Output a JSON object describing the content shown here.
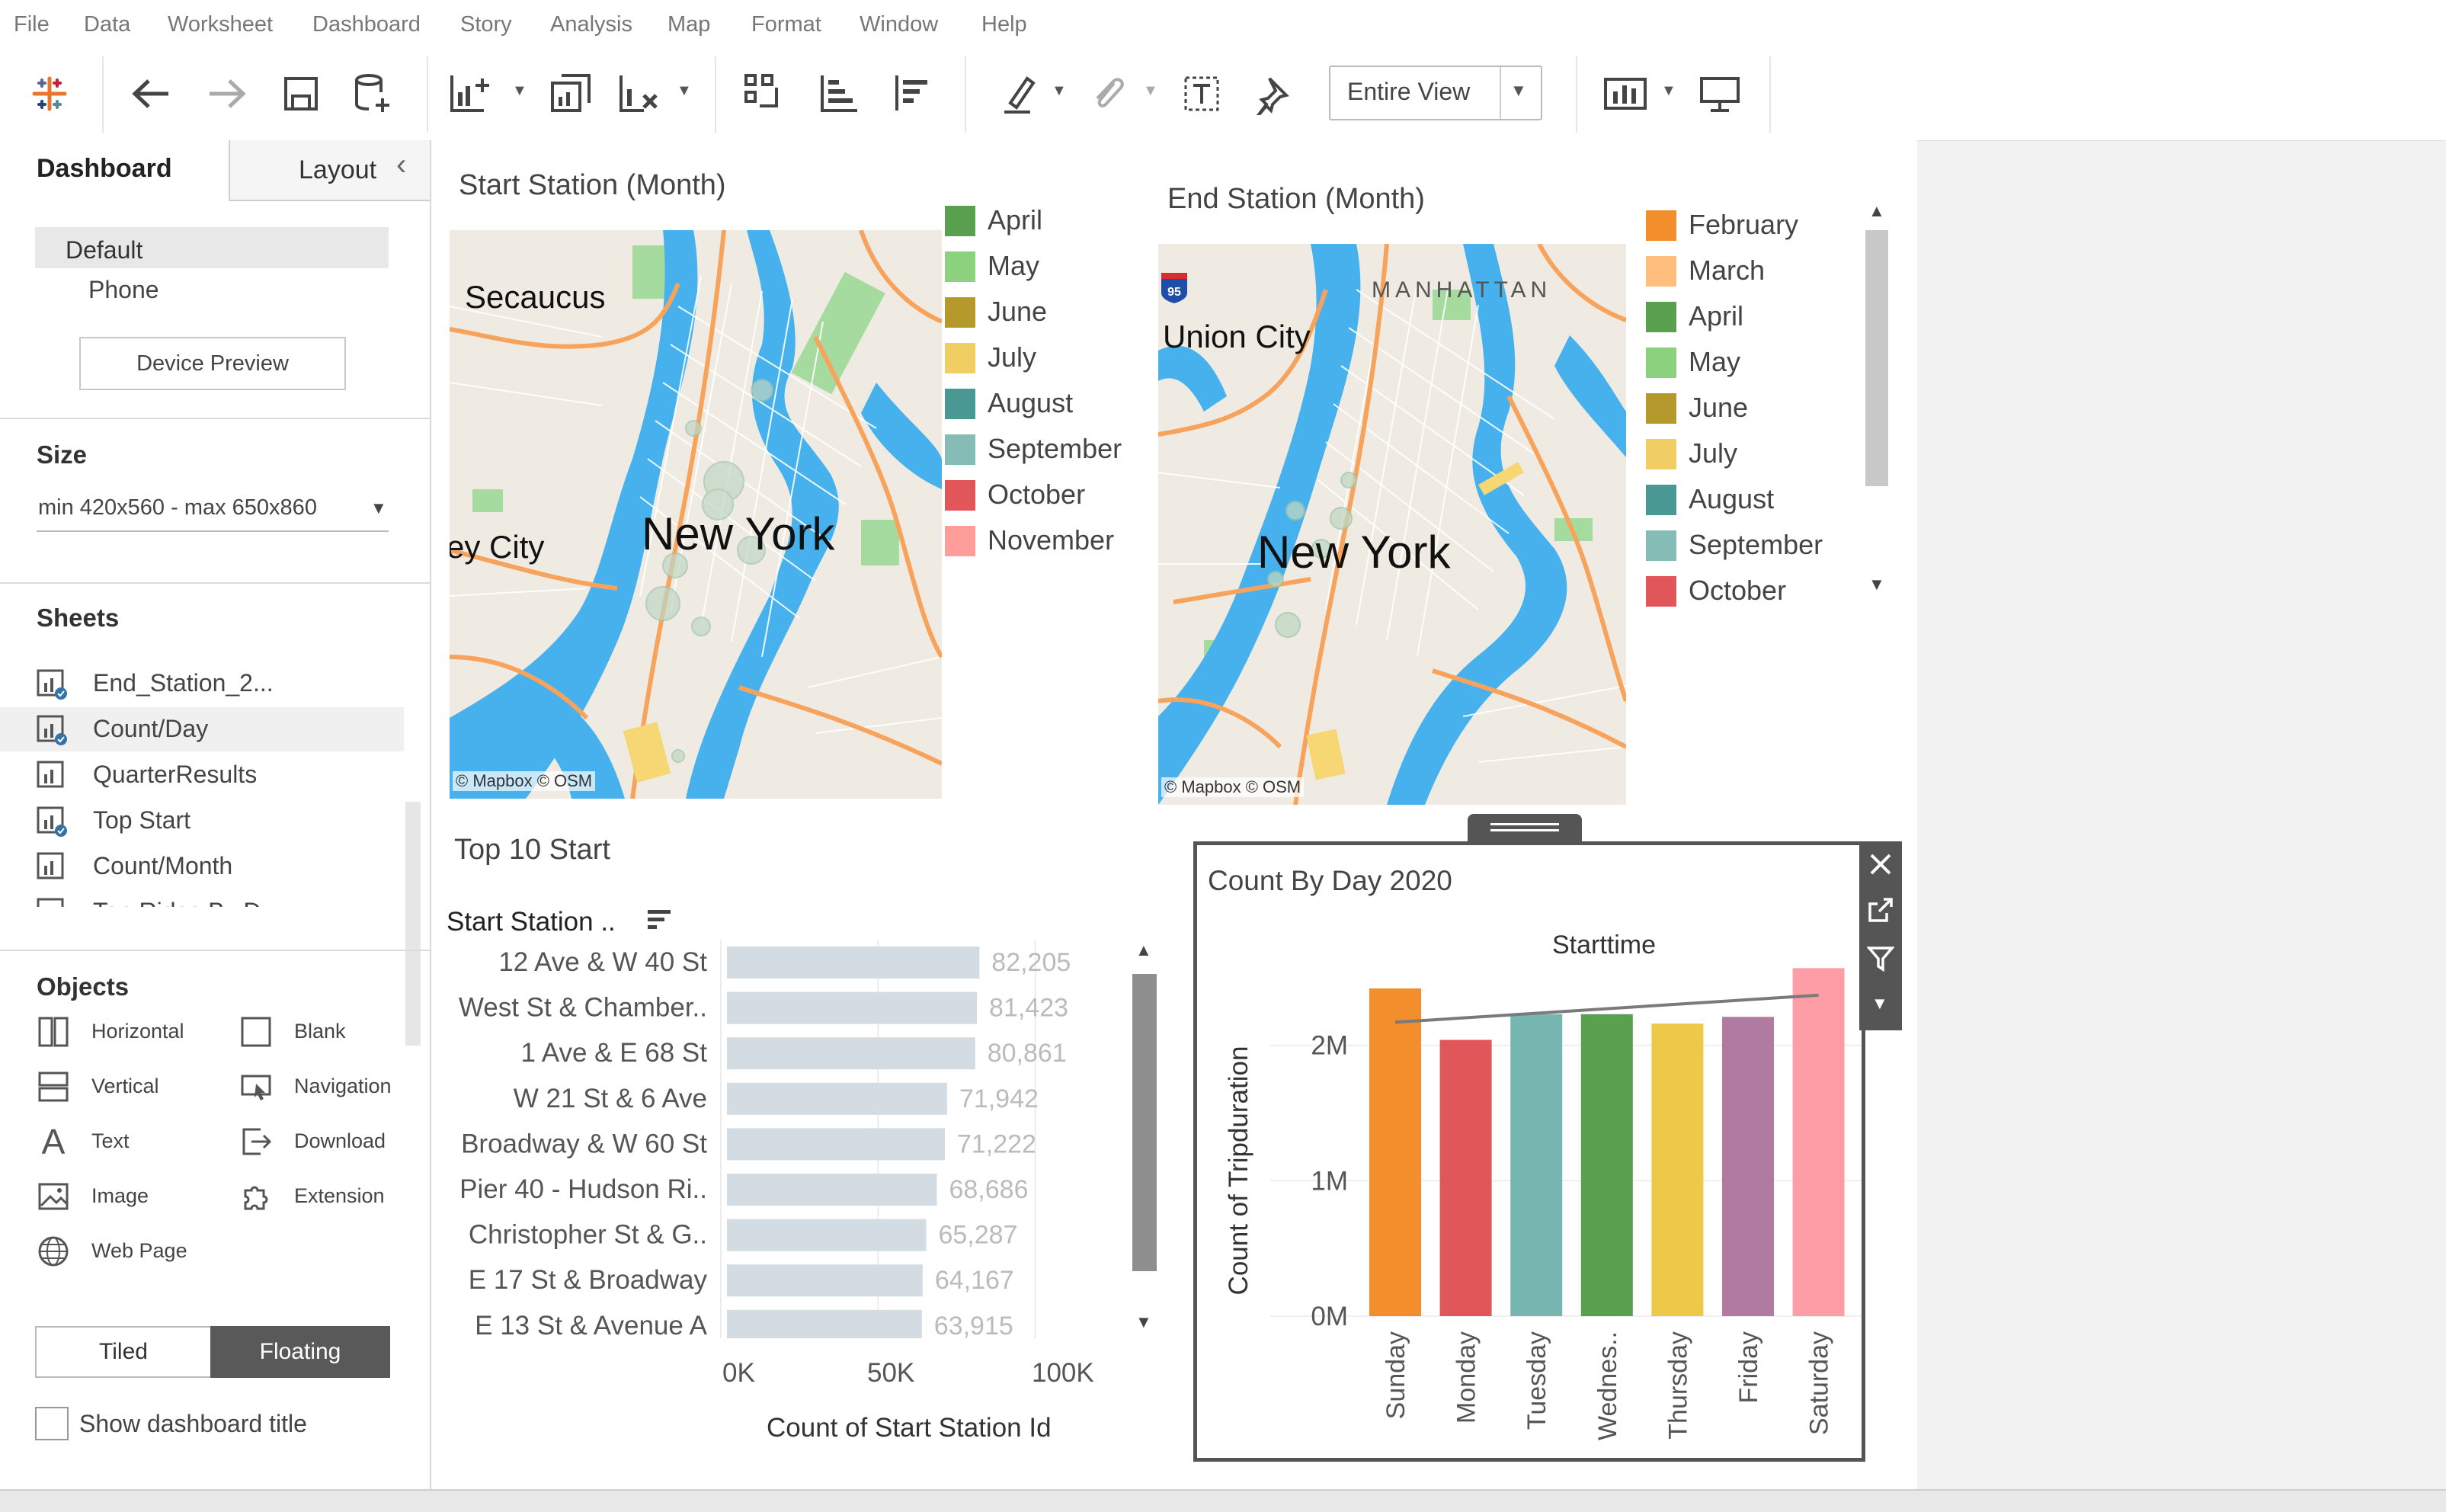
{
  "menu": [
    "File",
    "Data",
    "Worksheet",
    "Dashboard",
    "Story",
    "Analysis",
    "Map",
    "Format",
    "Window",
    "Help"
  ],
  "toolbar": {
    "fit_value": "Entire View"
  },
  "leftpane": {
    "tabs": [
      "Dashboard",
      "Layout"
    ],
    "device": {
      "default": "Default",
      "phone": "Phone",
      "preview_button": "Device Preview"
    },
    "size": {
      "title": "Size",
      "value": "min 420x560 - max 650x860"
    },
    "sheets": {
      "title": "Sheets",
      "items": [
        "End_Station_2...",
        "Count/Day",
        "QuarterResults",
        "Top Start",
        "Count/Month",
        "Top Rides By D..."
      ]
    },
    "objects": {
      "title": "Objects",
      "items": [
        "Horizontal",
        "Blank",
        "Vertical",
        "Navigation",
        "Text",
        "Download",
        "Image",
        "Extension",
        "Web Page"
      ]
    },
    "layout_toggle": [
      "Tiled",
      "Floating"
    ],
    "show_title": "Show dashboard title"
  },
  "start_map": {
    "title": "Start Station (Month)",
    "labels": {
      "secaucus": "Secaucus",
      "newyork": "New York",
      "city": "ey City"
    },
    "attribution": "© Mapbox © OSM",
    "legend": [
      {
        "label": "April",
        "color": "#59a14f"
      },
      {
        "label": "May",
        "color": "#8cd17d"
      },
      {
        "label": "June",
        "color": "#b6992d"
      },
      {
        "label": "July",
        "color": "#f1ce63"
      },
      {
        "label": "August",
        "color": "#499894"
      },
      {
        "label": "September",
        "color": "#86bcb6"
      },
      {
        "label": "October",
        "color": "#e15759"
      },
      {
        "label": "November",
        "color": "#ff9d9a"
      }
    ]
  },
  "end_map": {
    "title": "End Station (Month)",
    "labels": {
      "manhattan": "MANHATTAN",
      "union": "Union City",
      "newyork": "New York",
      "shield": "95"
    },
    "attribution": "© Mapbox © OSM",
    "legend": [
      {
        "label": "February",
        "color": "#f28e2b"
      },
      {
        "label": "March",
        "color": "#ffbe7d"
      },
      {
        "label": "April",
        "color": "#59a14f"
      },
      {
        "label": "May",
        "color": "#8cd17d"
      },
      {
        "label": "June",
        "color": "#b6992d"
      },
      {
        "label": "July",
        "color": "#f1ce63"
      },
      {
        "label": "August",
        "color": "#499894"
      },
      {
        "label": "September",
        "color": "#86bcb6"
      },
      {
        "label": "October",
        "color": "#e15759"
      }
    ]
  },
  "top_start": {
    "title": "Top 10 Start",
    "header": "Start Station ..",
    "axis_title": "Count of Start Station Id",
    "ticks": [
      "0K",
      "50K",
      "100K"
    ]
  },
  "count_by_day": {
    "title": "Count By Day 2020",
    "header": "Starttime",
    "ylabel": "Count of Tripduration",
    "yticks": [
      "0M",
      "1M",
      "2M"
    ]
  },
  "chart_data": [
    {
      "type": "bar",
      "orientation": "horizontal",
      "title": "Top 10 Start",
      "categories": [
        "12 Ave & W 40 St",
        "West St & Chamber..",
        "1 Ave & E 68 St",
        "W 21 St & 6 Ave",
        "Broadway & W 60 St",
        "Pier 40 - Hudson Ri..",
        "Christopher St & G..",
        "E 17 St & Broadway",
        "E 13 St & Avenue A"
      ],
      "values": [
        82205,
        81423,
        80861,
        71942,
        71222,
        68686,
        65287,
        64167,
        63915
      ],
      "value_labels": [
        "82,205",
        "81,423",
        "80,861",
        "71,942",
        "71,222",
        "68,686",
        "65,287",
        "64,167",
        "63,915"
      ],
      "xlabel": "Count of Start Station Id",
      "xlim": [
        0,
        110000
      ],
      "color": "#d3dbe3"
    },
    {
      "type": "bar",
      "title": "Count By Day 2020",
      "categories": [
        "Sunday",
        "Monday",
        "Tuesday",
        "Wednes..",
        "Thursday",
        "Friday",
        "Saturday"
      ],
      "values": [
        2420000,
        2040000,
        2230000,
        2230000,
        2160000,
        2210000,
        2570000
      ],
      "colors": [
        "#f28e2b",
        "#e15759",
        "#76b7b2",
        "#59a14f",
        "#edc948",
        "#b07aa1",
        "#ff9da7"
      ],
      "trend_line": [
        2170000,
        2370000
      ],
      "ylabel": "Count of Tripduration",
      "xlabel": "Starttime",
      "ylim": [
        0,
        2600000
      ]
    }
  ]
}
